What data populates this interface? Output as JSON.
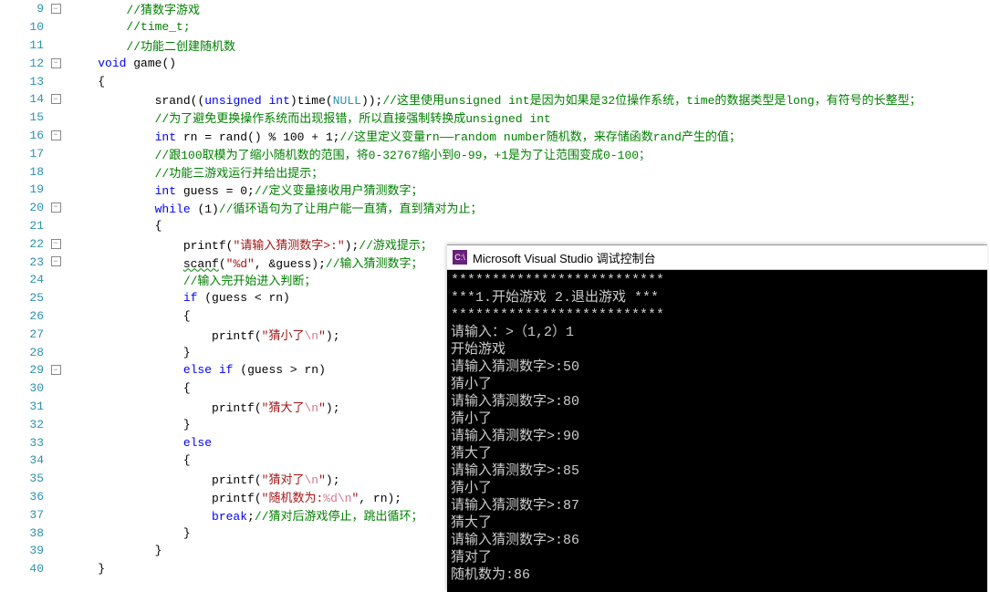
{
  "editor": {
    "lines": [
      {
        "num": 9,
        "outline": "box",
        "change": "green",
        "indent": 2,
        "tokens": [
          {
            "t": "comment",
            "v": "//猜数字游戏"
          }
        ]
      },
      {
        "num": 10,
        "outline": "line",
        "change": "green",
        "indent": 2,
        "tokens": [
          {
            "t": "comment",
            "v": "//time_t;"
          }
        ]
      },
      {
        "num": 11,
        "outline": "line",
        "change": "green",
        "indent": 2,
        "tokens": [
          {
            "t": "comment",
            "v": "//功能二创建随机数"
          }
        ]
      },
      {
        "num": 12,
        "outline": "box",
        "change": "green",
        "indent": 1,
        "tokens": [
          {
            "t": "keyword",
            "v": "void"
          },
          {
            "t": "punct",
            "v": " "
          },
          {
            "t": "ident",
            "v": "game"
          },
          {
            "t": "punct",
            "v": "()"
          }
        ]
      },
      {
        "num": 13,
        "outline": "line",
        "change": "green",
        "indent": 1,
        "tokens": [
          {
            "t": "punct",
            "v": "{"
          }
        ]
      },
      {
        "num": 14,
        "outline": "box",
        "change": "green",
        "indent": 3,
        "tokens": [
          {
            "t": "ident",
            "v": "srand"
          },
          {
            "t": "punct",
            "v": "(("
          },
          {
            "t": "keyword",
            "v": "unsigned"
          },
          {
            "t": "punct",
            "v": " "
          },
          {
            "t": "keyword",
            "v": "int"
          },
          {
            "t": "punct",
            "v": ")"
          },
          {
            "t": "ident",
            "v": "time"
          },
          {
            "t": "punct",
            "v": "("
          },
          {
            "t": "null",
            "v": "NULL"
          },
          {
            "t": "punct",
            "v": "));"
          },
          {
            "t": "comment",
            "v": "//这里使用unsigned int是因为如果是32位操作系统，time的数据类型是long，有符号的长整型；"
          }
        ]
      },
      {
        "num": 15,
        "outline": "line",
        "change": "green",
        "indent": 3,
        "tokens": [
          {
            "t": "comment",
            "v": "//为了避免更换操作系统而出现报错，所以直接强制转换成unsigned int"
          }
        ]
      },
      {
        "num": 16,
        "outline": "box",
        "change": "green",
        "indent": 3,
        "tokens": [
          {
            "t": "keyword",
            "v": "int"
          },
          {
            "t": "punct",
            "v": " rn = "
          },
          {
            "t": "ident",
            "v": "rand"
          },
          {
            "t": "punct",
            "v": "() % 100 + 1;"
          },
          {
            "t": "comment",
            "v": "//这里定义变量rn——random number随机数，来存储函数rand产生的值；"
          }
        ]
      },
      {
        "num": 17,
        "outline": "line",
        "change": "green",
        "indent": 3,
        "tokens": [
          {
            "t": "comment",
            "v": "//跟100取模为了缩小随机数的范围，将0-32767缩小到0-99，+1是为了让范围变成0-100；"
          }
        ]
      },
      {
        "num": 18,
        "outline": "line",
        "change": "yellow",
        "indent": 3,
        "tokens": [
          {
            "t": "comment",
            "v": "//功能三游戏运行并给出提示；"
          }
        ]
      },
      {
        "num": 19,
        "outline": "line",
        "change": "green",
        "indent": 3,
        "tokens": [
          {
            "t": "keyword",
            "v": "int"
          },
          {
            "t": "punct",
            "v": " guess = 0;"
          },
          {
            "t": "comment",
            "v": "//定义变量接收用户猜测数字；"
          }
        ]
      },
      {
        "num": 20,
        "outline": "box",
        "change": "green",
        "indent": 3,
        "tokens": [
          {
            "t": "keyword",
            "v": "while"
          },
          {
            "t": "punct",
            "v": " (1)"
          },
          {
            "t": "comment",
            "v": "//循环语句为了让用户能一直猜，直到猜对为止；"
          }
        ]
      },
      {
        "num": 21,
        "outline": "line",
        "change": "green",
        "indent": 3,
        "tokens": [
          {
            "t": "punct",
            "v": "{"
          }
        ]
      },
      {
        "num": 22,
        "outline": "box",
        "change": "green",
        "indent": 4,
        "tokens": [
          {
            "t": "ident",
            "v": "printf"
          },
          {
            "t": "punct",
            "v": "("
          },
          {
            "t": "string",
            "v": "\"请输入猜测数字>:\""
          },
          {
            "t": "punct",
            "v": ");"
          },
          {
            "t": "comment",
            "v": "//游戏提示；"
          }
        ]
      },
      {
        "num": 23,
        "outline": "box",
        "change": "green",
        "indent": 4,
        "tokens": [
          {
            "t": "identU",
            "v": "scanf"
          },
          {
            "t": "punct",
            "v": "("
          },
          {
            "t": "string",
            "v": "\"%d\""
          },
          {
            "t": "punct",
            "v": ", &guess);"
          },
          {
            "t": "comment",
            "v": "//输入猜测数字；"
          }
        ]
      },
      {
        "num": 24,
        "outline": "line",
        "change": "green",
        "indent": 4,
        "tokens": [
          {
            "t": "comment",
            "v": "//输入完开始进入判断；"
          }
        ]
      },
      {
        "num": 25,
        "outline": "line",
        "change": "green",
        "indent": 4,
        "tokens": [
          {
            "t": "keyword",
            "v": "if"
          },
          {
            "t": "punct",
            "v": " (guess < rn)"
          }
        ]
      },
      {
        "num": 26,
        "outline": "line",
        "change": "green",
        "indent": 4,
        "tokens": [
          {
            "t": "punct",
            "v": "{"
          }
        ]
      },
      {
        "num": 27,
        "outline": "line",
        "change": "green",
        "indent": 5,
        "tokens": [
          {
            "t": "ident",
            "v": "printf"
          },
          {
            "t": "punct",
            "v": "("
          },
          {
            "t": "string",
            "v": "\"猜小了"
          },
          {
            "t": "escape",
            "v": "\\n"
          },
          {
            "t": "string",
            "v": "\""
          },
          {
            "t": "punct",
            "v": ");"
          }
        ]
      },
      {
        "num": 28,
        "outline": "line",
        "change": "green",
        "indent": 4,
        "tokens": [
          {
            "t": "punct",
            "v": "}"
          }
        ]
      },
      {
        "num": 29,
        "outline": "box",
        "change": "green",
        "indent": 4,
        "tokens": [
          {
            "t": "keyword",
            "v": "else"
          },
          {
            "t": "punct",
            "v": " "
          },
          {
            "t": "keyword",
            "v": "if"
          },
          {
            "t": "punct",
            "v": " (guess > rn)"
          }
        ]
      },
      {
        "num": 30,
        "outline": "line",
        "change": "green",
        "indent": 4,
        "tokens": [
          {
            "t": "punct",
            "v": "{"
          }
        ]
      },
      {
        "num": 31,
        "outline": "line",
        "change": "green",
        "indent": 5,
        "tokens": [
          {
            "t": "ident",
            "v": "printf"
          },
          {
            "t": "punct",
            "v": "("
          },
          {
            "t": "string",
            "v": "\"猜大了"
          },
          {
            "t": "escape",
            "v": "\\n"
          },
          {
            "t": "string",
            "v": "\""
          },
          {
            "t": "punct",
            "v": ");"
          }
        ]
      },
      {
        "num": 32,
        "outline": "line",
        "change": "green",
        "indent": 4,
        "tokens": [
          {
            "t": "punct",
            "v": "}"
          }
        ]
      },
      {
        "num": 33,
        "outline": "line",
        "change": "green",
        "indent": 4,
        "tokens": [
          {
            "t": "keyword",
            "v": "else"
          }
        ]
      },
      {
        "num": 34,
        "outline": "line",
        "change": "green",
        "indent": 4,
        "tokens": [
          {
            "t": "punct",
            "v": "{"
          }
        ]
      },
      {
        "num": 35,
        "outline": "line",
        "change": "green",
        "indent": 5,
        "tokens": [
          {
            "t": "ident",
            "v": "printf"
          },
          {
            "t": "punct",
            "v": "("
          },
          {
            "t": "string",
            "v": "\"猜对了"
          },
          {
            "t": "escape",
            "v": "\\n"
          },
          {
            "t": "string",
            "v": "\""
          },
          {
            "t": "punct",
            "v": ");"
          }
        ]
      },
      {
        "num": 36,
        "outline": "line",
        "change": "green",
        "indent": 5,
        "tokens": [
          {
            "t": "ident",
            "v": "printf"
          },
          {
            "t": "punct",
            "v": "("
          },
          {
            "t": "string",
            "v": "\"随机数为:"
          },
          {
            "t": "escape",
            "v": "%d\\n"
          },
          {
            "t": "string",
            "v": "\""
          },
          {
            "t": "punct",
            "v": ", rn);"
          }
        ]
      },
      {
        "num": 37,
        "outline": "line",
        "change": "green",
        "indent": 5,
        "tokens": [
          {
            "t": "keyword",
            "v": "break"
          },
          {
            "t": "punct",
            "v": ";"
          },
          {
            "t": "comment",
            "v": "//猜对后游戏停止，跳出循环；"
          }
        ]
      },
      {
        "num": 38,
        "outline": "line",
        "change": "green",
        "indent": 4,
        "tokens": [
          {
            "t": "punct",
            "v": "}"
          }
        ]
      },
      {
        "num": 39,
        "outline": "line",
        "change": "green",
        "indent": 3,
        "tokens": [
          {
            "t": "punct",
            "v": "}"
          }
        ]
      },
      {
        "num": 40,
        "outline": "line",
        "change": "",
        "indent": 1,
        "tokens": [
          {
            "t": "punct",
            "v": "}"
          }
        ]
      }
    ]
  },
  "console": {
    "title": "Microsoft Visual Studio 调试控制台",
    "lines": [
      "**************************",
      "***1.开始游戏 2.退出游戏 ***",
      "**************************",
      "请输入：>（1,2）1",
      "开始游戏",
      "请输入猜测数字>:50",
      "猜小了",
      "请输入猜测数字>:80",
      "猜小了",
      "请输入猜测数字>:90",
      "猜大了",
      "请输入猜测数字>:85",
      "猜小了",
      "请输入猜测数字>:87",
      "猜大了",
      "请输入猜测数字>:86",
      "猜对了",
      "随机数为:86"
    ]
  }
}
